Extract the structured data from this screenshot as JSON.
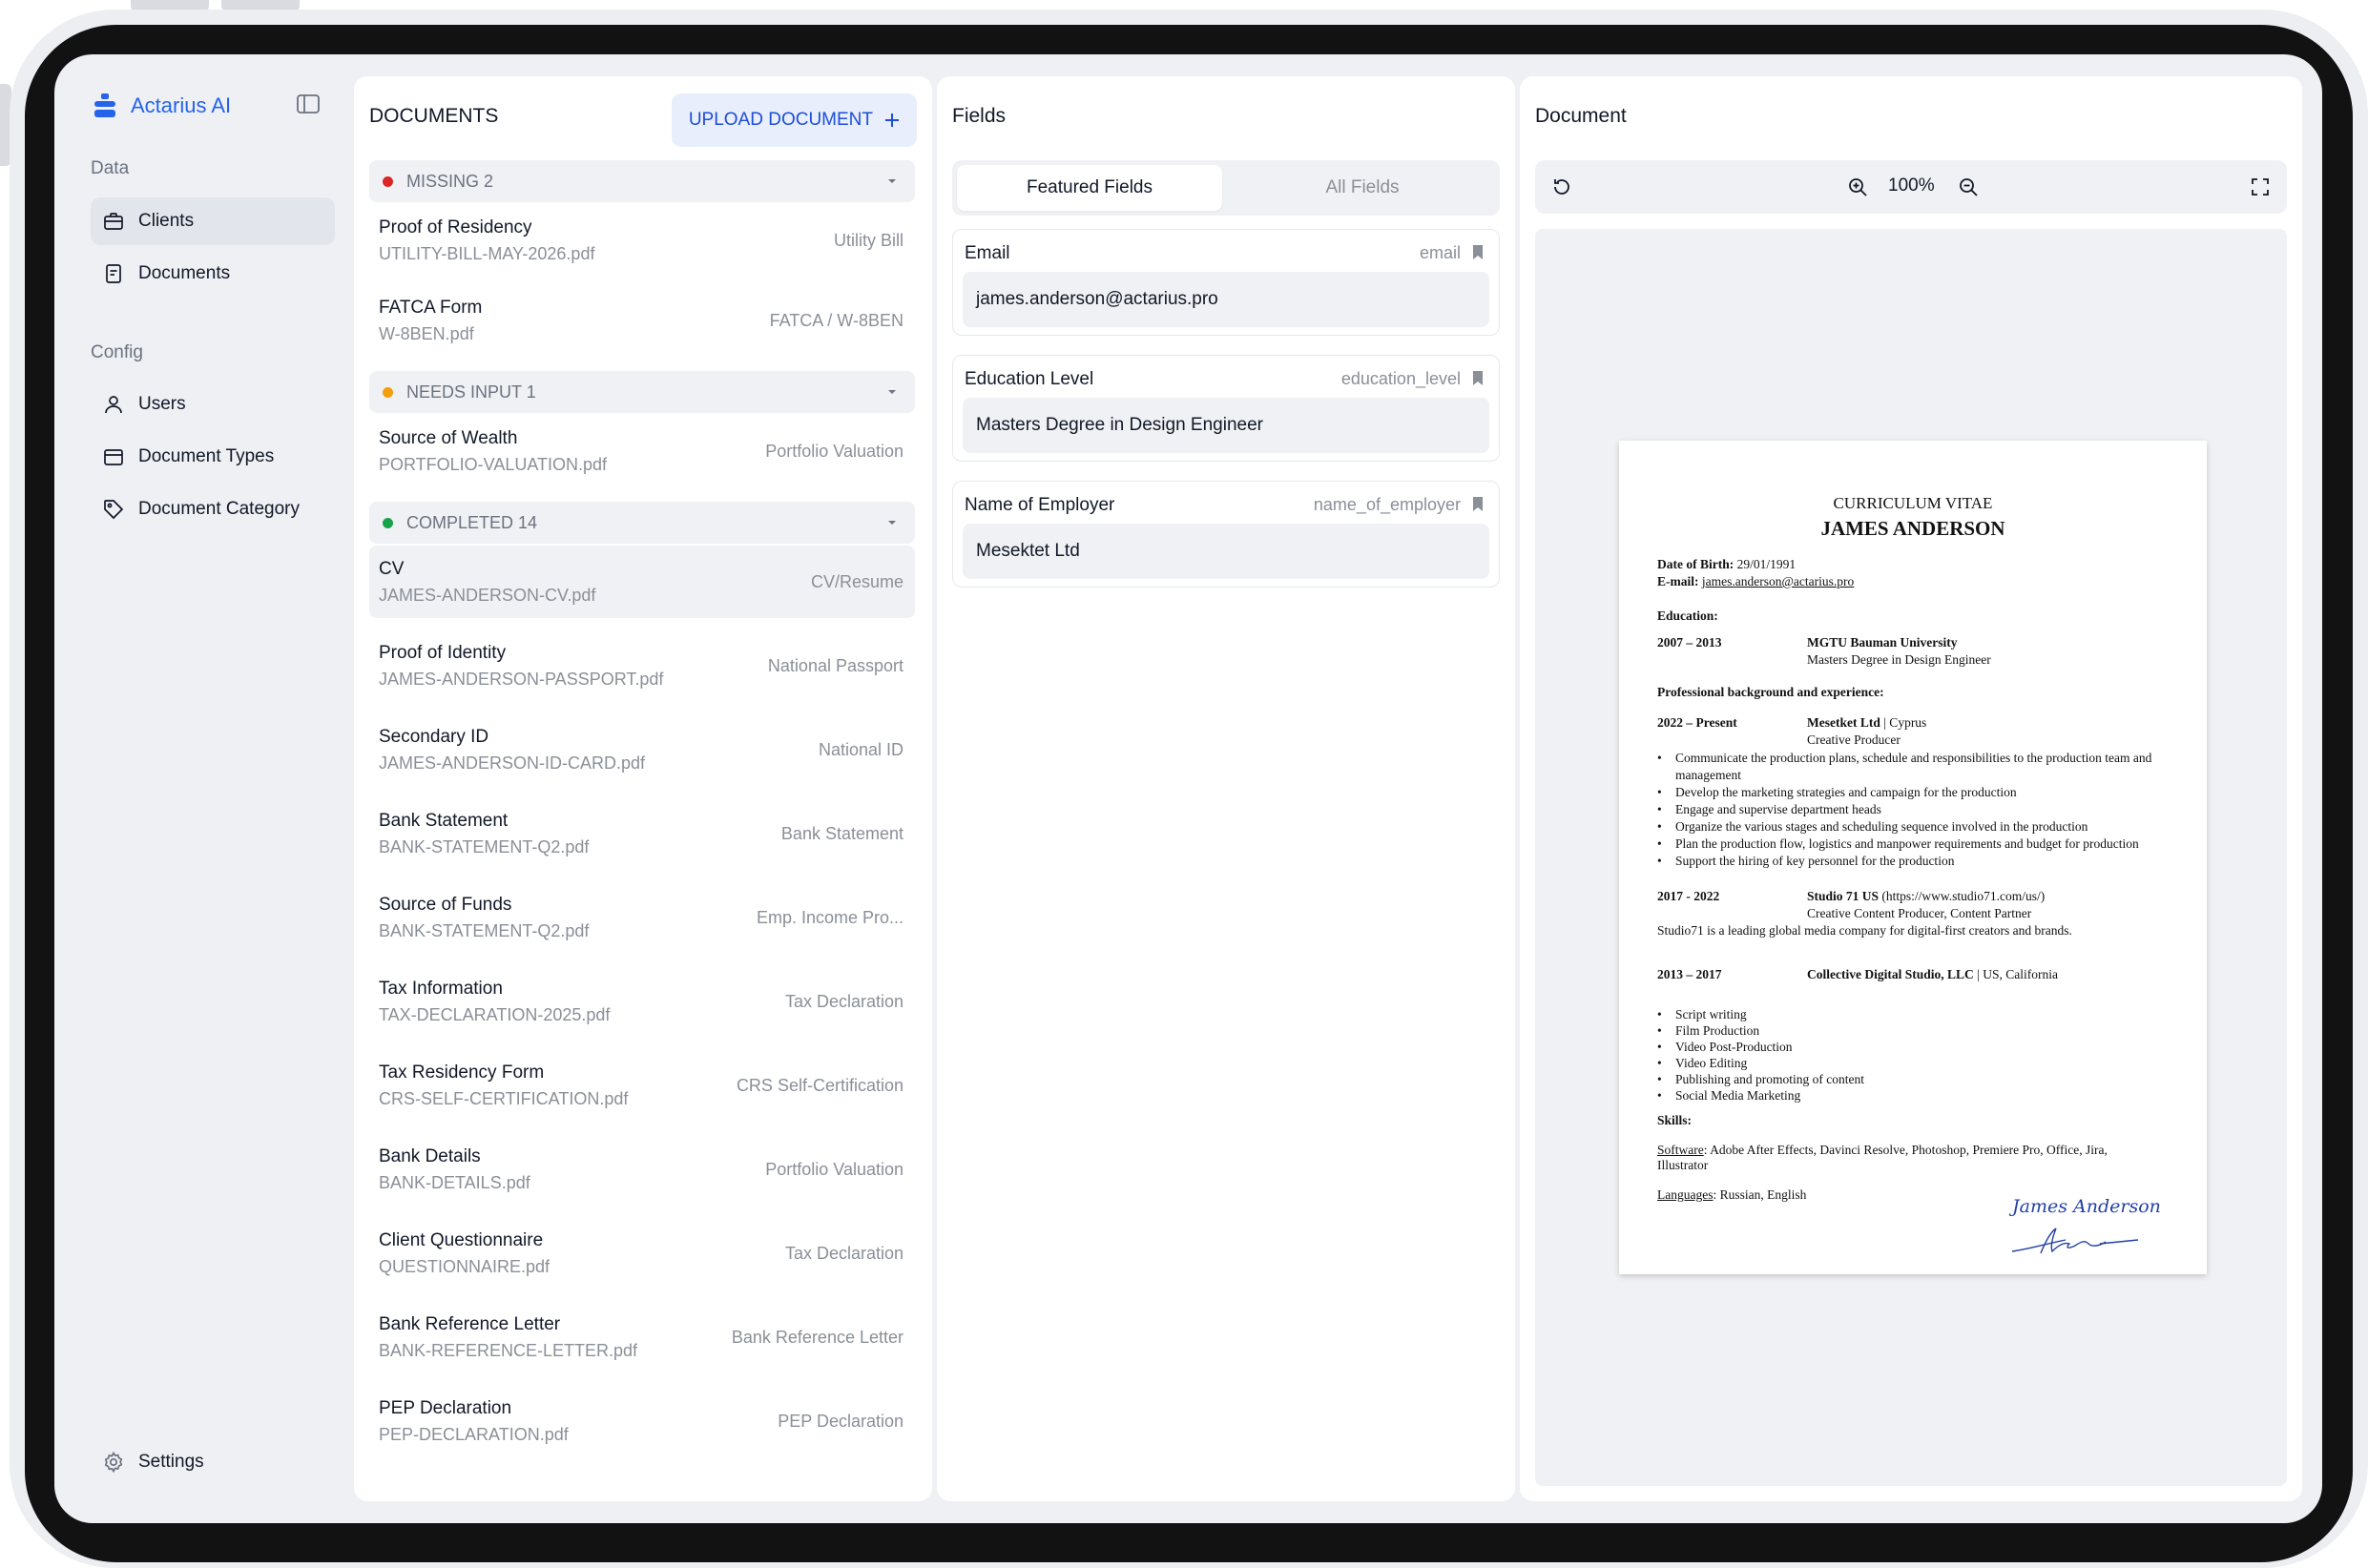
{
  "app": {
    "brand_name": "Actarius AI",
    "accent_color": "#2563eb"
  },
  "sidebar": {
    "data_label": "Data",
    "config_label": "Config",
    "data_items": [
      {
        "label": "Clients",
        "icon": "briefcase-icon",
        "active": true
      },
      {
        "label": "Documents",
        "icon": "document-icon",
        "active": false
      }
    ],
    "config_items": [
      {
        "label": "Users",
        "icon": "user-icon"
      },
      {
        "label": "Document Types",
        "icon": "folder-icon"
      },
      {
        "label": "Document Category",
        "icon": "tag-icon"
      }
    ],
    "settings_label": "Settings"
  },
  "documents": {
    "title": "DOCUMENTS",
    "upload_label": "UPLOAD DOCUMENT",
    "groups": [
      {
        "label": "MISSING 2",
        "color": "#dc2626"
      },
      {
        "label": "NEEDS INPUT 1",
        "color": "#f59e0b"
      },
      {
        "label": "COMPLETED 14",
        "color": "#16a34a"
      }
    ],
    "rows": [
      {
        "name": "Proof of Residency",
        "file": "UTILITY-BILL-MAY-2026.pdf",
        "type": "Utility Bill"
      },
      {
        "name": "FATCA Form",
        "file": "W-8BEN.pdf",
        "type": "FATCA / W-8BEN"
      },
      {
        "name": "Source of Wealth",
        "file": "PORTFOLIO-VALUATION.pdf",
        "type": "Portfolio Valuation"
      },
      {
        "name": "CV",
        "file": "JAMES-ANDERSON-CV.pdf",
        "type": "CV/Resume"
      },
      {
        "name": "Proof of Identity",
        "file": "JAMES-ANDERSON-PASSPORT.pdf",
        "type": "National Passport"
      },
      {
        "name": "Secondary ID",
        "file": "JAMES-ANDERSON-ID-CARD.pdf",
        "type": "National ID"
      },
      {
        "name": "Bank Statement",
        "file": "BANK-STATEMENT-Q2.pdf",
        "type": "Bank Statement"
      },
      {
        "name": "Source of Funds",
        "file": "BANK-STATEMENT-Q2.pdf",
        "type": "Emp. Income Pro..."
      },
      {
        "name": "Tax Information",
        "file": "TAX-DECLARATION-2025.pdf",
        "type": "Tax Declaration"
      },
      {
        "name": "Tax Residency Form",
        "file": "CRS-SELF-CERTIFICATION.pdf",
        "type": "CRS Self-Certification"
      },
      {
        "name": "Bank Details",
        "file": "BANK-DETAILS.pdf",
        "type": "Portfolio Valuation"
      },
      {
        "name": "Client Questionnaire",
        "file": "QUESTIONNAIRE.pdf",
        "type": "Tax Declaration"
      },
      {
        "name": "Bank Reference Letter",
        "file": "BANK-REFERENCE-LETTER.pdf",
        "type": "Bank Reference Letter"
      },
      {
        "name": "PEP Declaration",
        "file": "PEP-DECLARATION.pdf",
        "type": "PEP Declaration"
      }
    ]
  },
  "fields": {
    "title": "Fields",
    "tabs": [
      "Featured Fields",
      "All Fields"
    ],
    "active_tab": "Featured Fields",
    "items": [
      {
        "label": "Email",
        "key": "email",
        "value": "james.anderson@actarius.pro"
      },
      {
        "label": "Education Level",
        "key": "education_level",
        "value": "Masters Degree in Design Engineer"
      },
      {
        "label": "Name of Employer",
        "key": "name_of_employer",
        "value": "Mesektet Ltd"
      }
    ]
  },
  "viewer": {
    "title": "Document",
    "zoom": "100%"
  },
  "cv": {
    "heading": "CURRICULUM VITAE",
    "name": "JAMES ANDERSON",
    "dob_label": "Date of Birth:",
    "dob": "29/01/1991",
    "email_label": "E-mail:",
    "email": "james.anderson@actarius.pro",
    "education_label": "Education:",
    "edu_years": "2007 – 2013",
    "edu_school": "MGTU Bauman University",
    "edu_degree": "Masters Degree in Design Engineer",
    "experience_label": "Professional background and experience:",
    "job1_years": "2022 – Present",
    "job1_company": "Mesetket Ltd",
    "job1_location": " | Cyprus",
    "job1_role": "Creative Producer",
    "job1_bullets": [
      "Communicate the production plans, schedule and responsibilities to the production team and",
      "Develop the marketing strategies and campaign for the production",
      "Engage and supervise department heads",
      "Organize the various stages and scheduling sequence involved in the production",
      "Plan the production flow, logistics and manpower requirements and budget for production",
      "Support the hiring of key personnel for the production"
    ],
    "job1_bullet_cont": "management",
    "job2_years": "2017 - 2022",
    "job2_company": "Studio 71 US",
    "job2_url": " (https://www.studio71.com/us/)",
    "job2_role": "Creative Content Producer, Content Partner",
    "job2_desc": "Studio71 is a leading global media company for digital-first creators and brands.",
    "job3_years": "2013 – 2017",
    "job3_company": "Collective Digital Studio, LLC",
    "job3_location": " | US, California",
    "job3_bullets": [
      "Script writing",
      "Film Production",
      "Video Post-Production",
      "Video Editing",
      "Publishing and promoting of content",
      "Social Media Marketing"
    ],
    "skills_label": "Skills:",
    "software_label": "Software",
    "software": ": Adobe After Effects, Davinci Resolve, Photoshop, Premiere Pro, Office, Jira,",
    "software_cont": "Illustrator",
    "languages_label": "Languages",
    "languages": ": Russian, English",
    "signature_name": "James Anderson"
  }
}
